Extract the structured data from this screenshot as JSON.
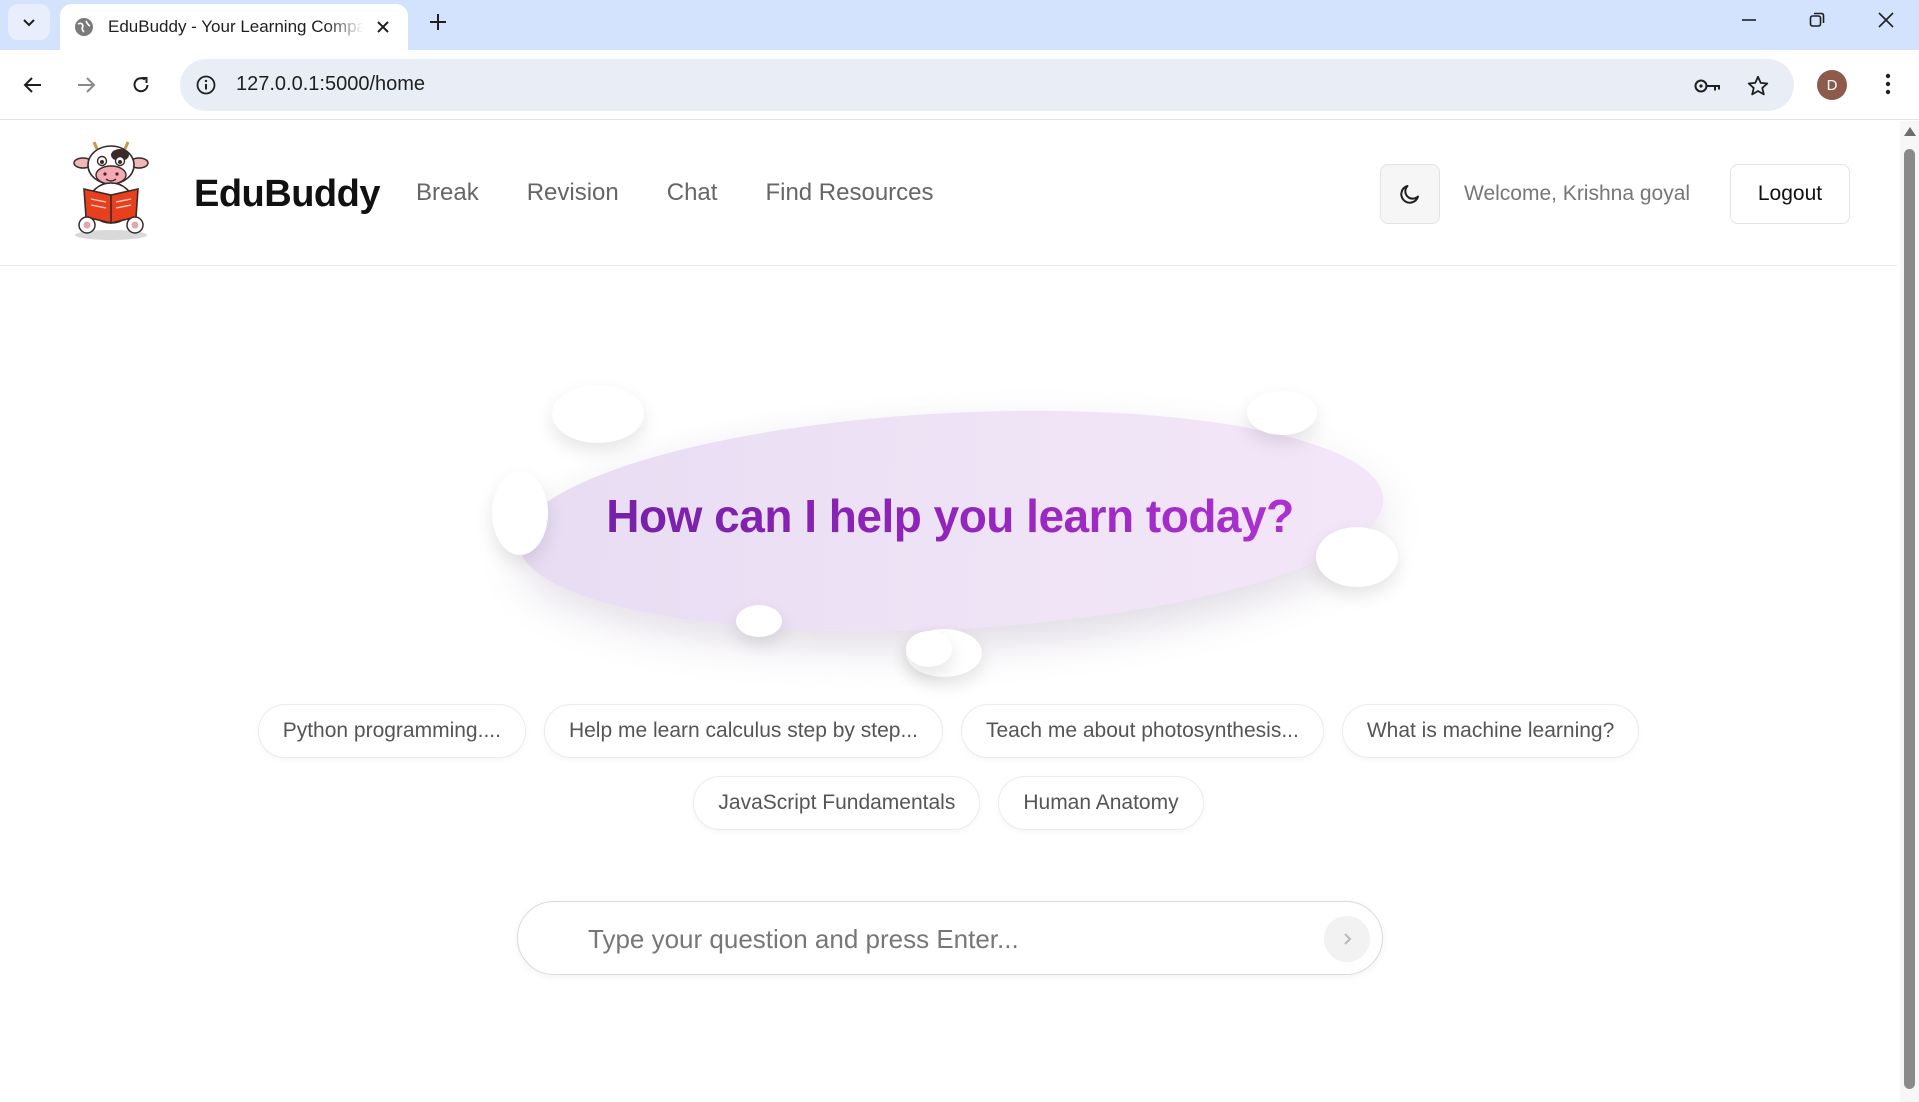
{
  "browser": {
    "tab_title": "EduBuddy - Your Learning Companion",
    "url": "127.0.0.1:5000/home",
    "profile_initial": "D"
  },
  "header": {
    "brand": "EduBuddy",
    "nav": [
      "Break",
      "Revision",
      "Chat",
      "Find Resources"
    ],
    "welcome": "Welcome, Krishna goyal",
    "logout_label": "Logout"
  },
  "hero": {
    "title": "How can I help you learn today?"
  },
  "suggestions": {
    "row1": [
      "Python programming....",
      "Help me learn calculus step by step...",
      "Teach me about photosynthesis...",
      "What is machine learning?"
    ],
    "row2": [
      "JavaScript Fundamentals",
      "Human Anatomy"
    ]
  },
  "ask": {
    "placeholder": "Type your question and press Enter..."
  },
  "colors": {
    "accent_start": "#6b1fa0",
    "accent_end": "#b636d9",
    "tabstrip": "#d3e3fd"
  },
  "icons": [
    "tab-search-icon",
    "globe-icon",
    "close-icon",
    "plus-icon",
    "minimize-icon",
    "restore-icon",
    "window-close-icon",
    "back-icon",
    "forward-icon",
    "reload-icon",
    "info-icon",
    "key-icon",
    "star-icon",
    "kebab-menu-icon",
    "moon-icon",
    "chevron-right-icon"
  ]
}
